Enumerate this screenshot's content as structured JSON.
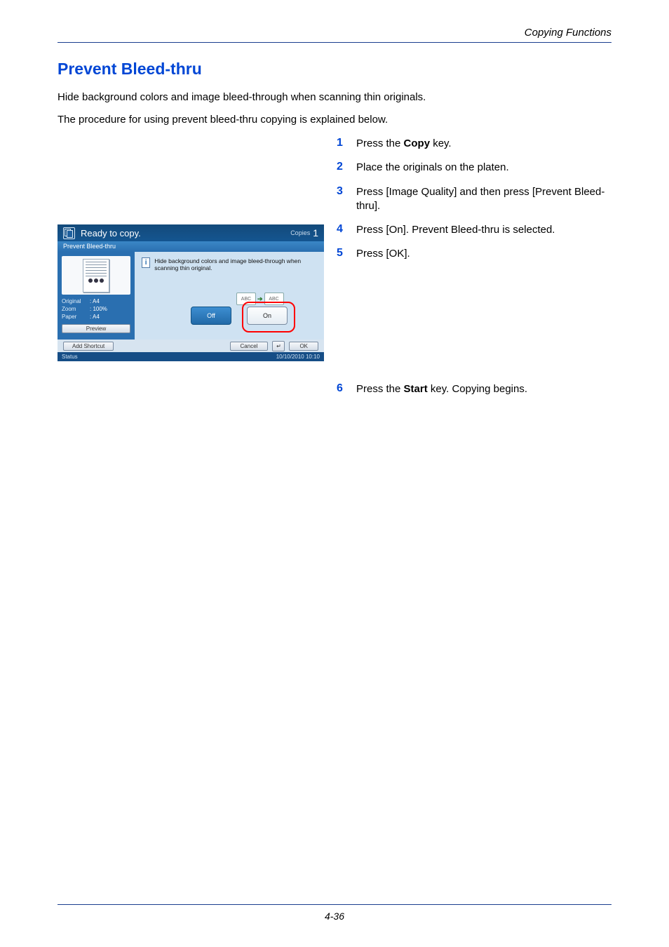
{
  "header": {
    "section": "Copying Functions"
  },
  "title": "Prevent Bleed-thru",
  "intro": {
    "line1": "Hide background colors and image bleed-through when scanning thin originals.",
    "line2": "The procedure for using prevent bleed-thru copying is explained below."
  },
  "steps": {
    "s1": "Press the Copy key.",
    "s2": "Place the originals on the platen.",
    "s3": "Press [Image Quality] and then press [Prevent Bleed-thru].",
    "s4": "Press [On]. Prevent Bleed-thru is selected.",
    "s5": "Press [OK].",
    "s6": "Press the Start key. Copying begins."
  },
  "step_labels": {
    "n1": "1",
    "n2": "2",
    "n3": "3",
    "n4": "4",
    "n5": "5",
    "n6": "6"
  },
  "bold_terms": {
    "copy": "Copy",
    "start": "Start"
  },
  "panel": {
    "title": "Ready to copy.",
    "copies_label": "Copies",
    "copies_value": "1",
    "tab": "Prevent Bleed-thru",
    "info": "Hide background colors and image bleed-through\nwhen scanning thin original.",
    "abc1": "ABC",
    "abc2": "ABC",
    "off": "Off",
    "on": "On",
    "meta": {
      "original_k": "Original",
      "original_v": ": A4",
      "zoom_k": "Zoom",
      "zoom_v": ": 100%",
      "paper_k": "Paper",
      "paper_v": ": A4"
    },
    "preview_btn": "Preview",
    "add_shortcut": "Add Shortcut",
    "cancel": "Cancel",
    "ok": "OK",
    "back": "↵",
    "status": "Status",
    "timestamp": "10/10/2010  10:10"
  },
  "footer": {
    "page": "4-36"
  }
}
